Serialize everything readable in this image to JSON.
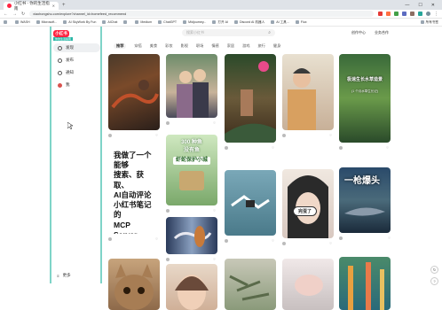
{
  "browser": {
    "tab_title": "小红书 - 你的生活指南",
    "url": "xiaohongshu.com/explore?channel_id=homefeed_recommend",
    "bookmarks": [
      "",
      "WASH",
      "Microsoft...",
      "AI SkyWork By Fun",
      "AIChat",
      "",
      "Medium",
      "ChatGPT",
      "Midjourney...",
      "打开 AI",
      "Discord AI 机器人",
      "AI 工具...",
      "Flux",
      "所有书签"
    ]
  },
  "app": {
    "logo": "小红书",
    "logo_sub": "你的生活指南",
    "sidebar": [
      {
        "label": "发现",
        "icon": "compass-icon",
        "active": true
      },
      {
        "label": "发布",
        "icon": "plus-icon",
        "active": false
      },
      {
        "label": "通知",
        "icon": "bell-icon",
        "active": false
      },
      {
        "label": "我",
        "icon": "user-icon",
        "active": false
      }
    ],
    "more_label": "更多",
    "search_placeholder": "搜索小红书",
    "top_links": [
      "创作中心",
      "业务合作"
    ],
    "channels": [
      "推荐",
      "穿搭",
      "美食",
      "彩妆",
      "影视",
      "职场",
      "情感",
      "家居",
      "游戏",
      "旅行",
      "健身"
    ]
  },
  "feed": {
    "cards": [
      {
        "title": "",
        "author": "",
        "likes": ""
      },
      {
        "title": "",
        "author": "",
        "likes": ""
      },
      {
        "title": "",
        "author": "",
        "likes": ""
      },
      {
        "title": "",
        "author": "",
        "likes": ""
      },
      {
        "title": "",
        "author": "",
        "likes": ""
      },
      {
        "title": "",
        "author": "",
        "likes": ""
      },
      {
        "title": "",
        "author": "",
        "likes": ""
      },
      {
        "title": "",
        "author": "",
        "likes": ""
      },
      {
        "title": "",
        "author": "",
        "likes": ""
      },
      {
        "title": "",
        "author": "",
        "likes": ""
      },
      {
        "title": "",
        "author": "",
        "likes": ""
      }
    ],
    "text_card_lines": [
      "我做了一个能够",
      "搜索、获取、",
      "AI自动评论",
      "小红书笔记的",
      "MCP Server"
    ],
    "overlay_texts": {
      "fish_card": [
        "300 种鱼",
        "没有鱼",
        "虾蛇保护小城"
      ],
      "drone_card": "完蛋了",
      "shark_card": "一枪爆头",
      "plant_card": "极速生长水草造景",
      "plant_card_sub": "(1 个月水草生长记)"
    }
  },
  "float_buttons": [
    "↻",
    "?"
  ],
  "colors": {
    "brand": "#ff2442",
    "sidebar_border": "#7fd4c8",
    "accent_green": "#28b6a6"
  }
}
